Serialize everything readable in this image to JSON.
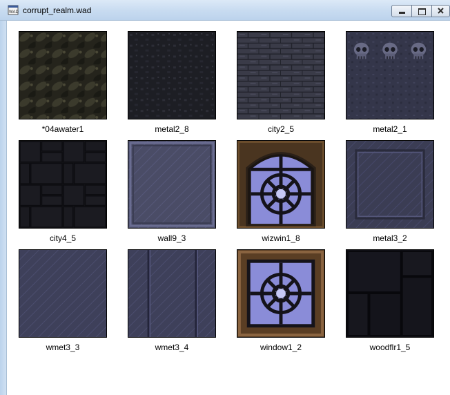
{
  "window": {
    "title": "corrupt_realm.wad",
    "icon": "wad-file-icon",
    "controls": [
      "minimize-icon",
      "maximize-icon",
      "close-icon"
    ]
  },
  "textures": [
    {
      "name": "*04awater1"
    },
    {
      "name": "metal2_8"
    },
    {
      "name": "city2_5"
    },
    {
      "name": "metal2_1"
    },
    {
      "name": "city4_5"
    },
    {
      "name": "wall9_3"
    },
    {
      "name": "wizwin1_8"
    },
    {
      "name": "metal3_2"
    },
    {
      "name": "wmet3_3"
    },
    {
      "name": "wmet3_4"
    },
    {
      "name": "window1_2"
    },
    {
      "name": "woodflr1_5"
    }
  ]
}
